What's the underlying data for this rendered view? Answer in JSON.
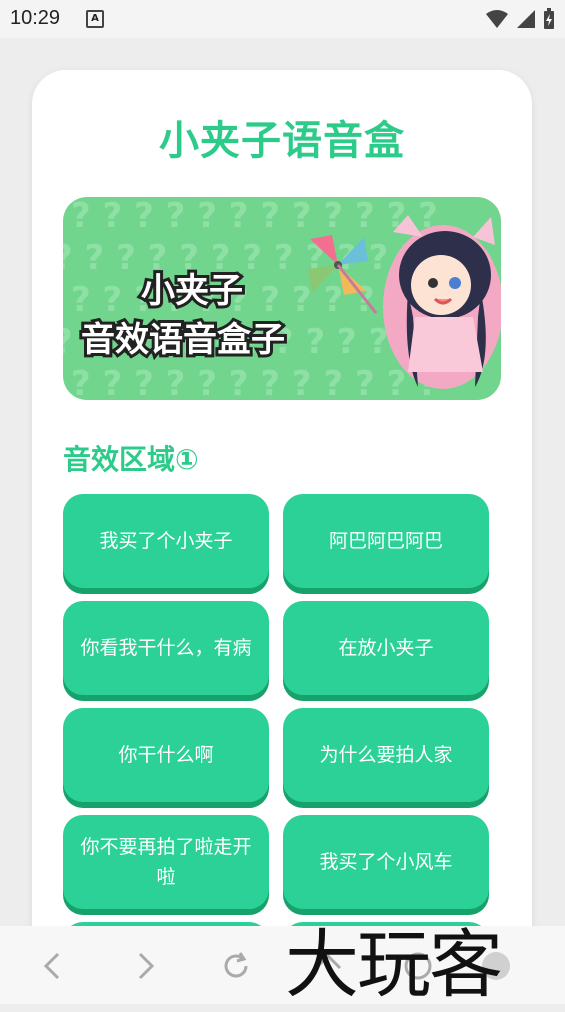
{
  "status": {
    "time": "10:29",
    "badge": "A"
  },
  "app": {
    "title": "小夹子语音盒"
  },
  "banner": {
    "line1": "小夹子",
    "line2": "音效语音盒子"
  },
  "section": {
    "title": "音效区域①"
  },
  "buttons": [
    {
      "label": "我买了个小夹子"
    },
    {
      "label": "阿巴阿巴阿巴"
    },
    {
      "label": "你看我干什么，有病"
    },
    {
      "label": "在放小夹子"
    },
    {
      "label": "你干什么啊"
    },
    {
      "label": "为什么要拍人家"
    },
    {
      "label": "你不要再拍了啦走开啦"
    },
    {
      "label": "我买了个小风车"
    }
  ],
  "watermark": {
    "text": "大玩客"
  },
  "colors": {
    "accent": "#2dcb8a",
    "button": "#2bd196",
    "banner": "#72d58e"
  },
  "icons": [
    "wifi-icon",
    "signal-icon",
    "battery-icon",
    "back-icon",
    "forward-icon",
    "refresh-icon",
    "home-icon",
    "menu-icon"
  ]
}
